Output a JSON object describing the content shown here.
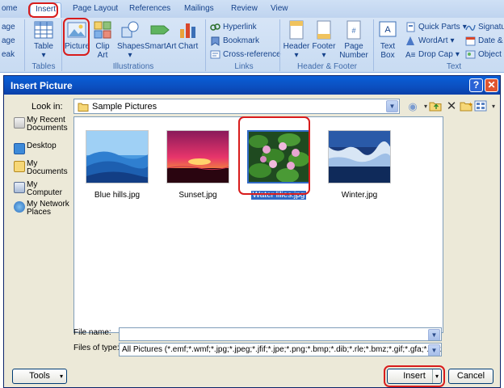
{
  "ribbon": {
    "tabs": [
      "ome",
      "Insert",
      "Page Layout",
      "References",
      "Mailings",
      "Review",
      "View"
    ],
    "left_partial": [
      "age",
      "age",
      "eak"
    ],
    "tables": {
      "table_label": "Table",
      "group_label": "Tables"
    },
    "illustrations": {
      "picture_label": "Picture",
      "clipart_label": "Clip Art",
      "clipart_line1": "Clip",
      "clipart_line2": "Art",
      "shapes_label": "Shapes",
      "smartart_label": "SmartArt",
      "chart_label": "Chart",
      "group_label": "Illustrations"
    },
    "links": {
      "hyperlink_label": "Hyperlink",
      "bookmark_label": "Bookmark",
      "crossref_label": "Cross-reference",
      "group_label": "Links"
    },
    "header_footer": {
      "header_label": "Header",
      "footer_label": "Footer",
      "page_number_line1": "Page",
      "page_number_line2": "Number",
      "group_label": "Header & Footer"
    },
    "text": {
      "textbox_line1": "Text",
      "textbox_line2": "Box",
      "quickparts_label": "Quick Parts",
      "wordart_label": "WordArt",
      "dropcap_label": "Drop Cap",
      "signature_label": "Signatu",
      "datetime_label": "Date &",
      "object_label": "Object",
      "group_label": "Text"
    }
  },
  "dialog": {
    "title": "Insert Picture",
    "help_glyph": "?",
    "close_glyph": "✕",
    "look_in_label": "Look in:",
    "look_in_value": "Sample Pictures",
    "places": [
      {
        "label": "My Recent Documents",
        "line1": "My Recent",
        "line2": "Documents"
      },
      {
        "label": "Desktop",
        "line1": "Desktop",
        "line2": ""
      },
      {
        "label": "My Documents",
        "line1": "My",
        "line2": "Documents"
      },
      {
        "label": "My Computer",
        "line1": "My",
        "line2": "Computer"
      },
      {
        "label": "My Network Places",
        "line1": "My Network",
        "line2": "Places"
      }
    ],
    "files": [
      {
        "name": "Blue hills.jpg",
        "selected": false
      },
      {
        "name": "Sunset.jpg",
        "selected": false
      },
      {
        "name": "Water lilies.jpg",
        "selected": true
      },
      {
        "name": "Winter.jpg",
        "selected": false
      }
    ],
    "file_name_label": "File name:",
    "file_name_value": "",
    "files_of_type_label": "Files of type:",
    "files_of_type_value": "All Pictures (*.emf;*.wmf;*.jpg;*.jpeg;*.jfif;*.jpe;*.png;*.bmp;*.dib;*.rle;*.bmz;*.gif;*.gfa;*.emz",
    "tools_label": "Tools",
    "insert_label": "Insert",
    "cancel_label": "Cancel"
  },
  "colors": {
    "title_bar": "#0b4fbf",
    "selection": "#316ac5",
    "highlight_annotation": "#d81c1c",
    "ribbon_bg": "#c8dbf2"
  }
}
